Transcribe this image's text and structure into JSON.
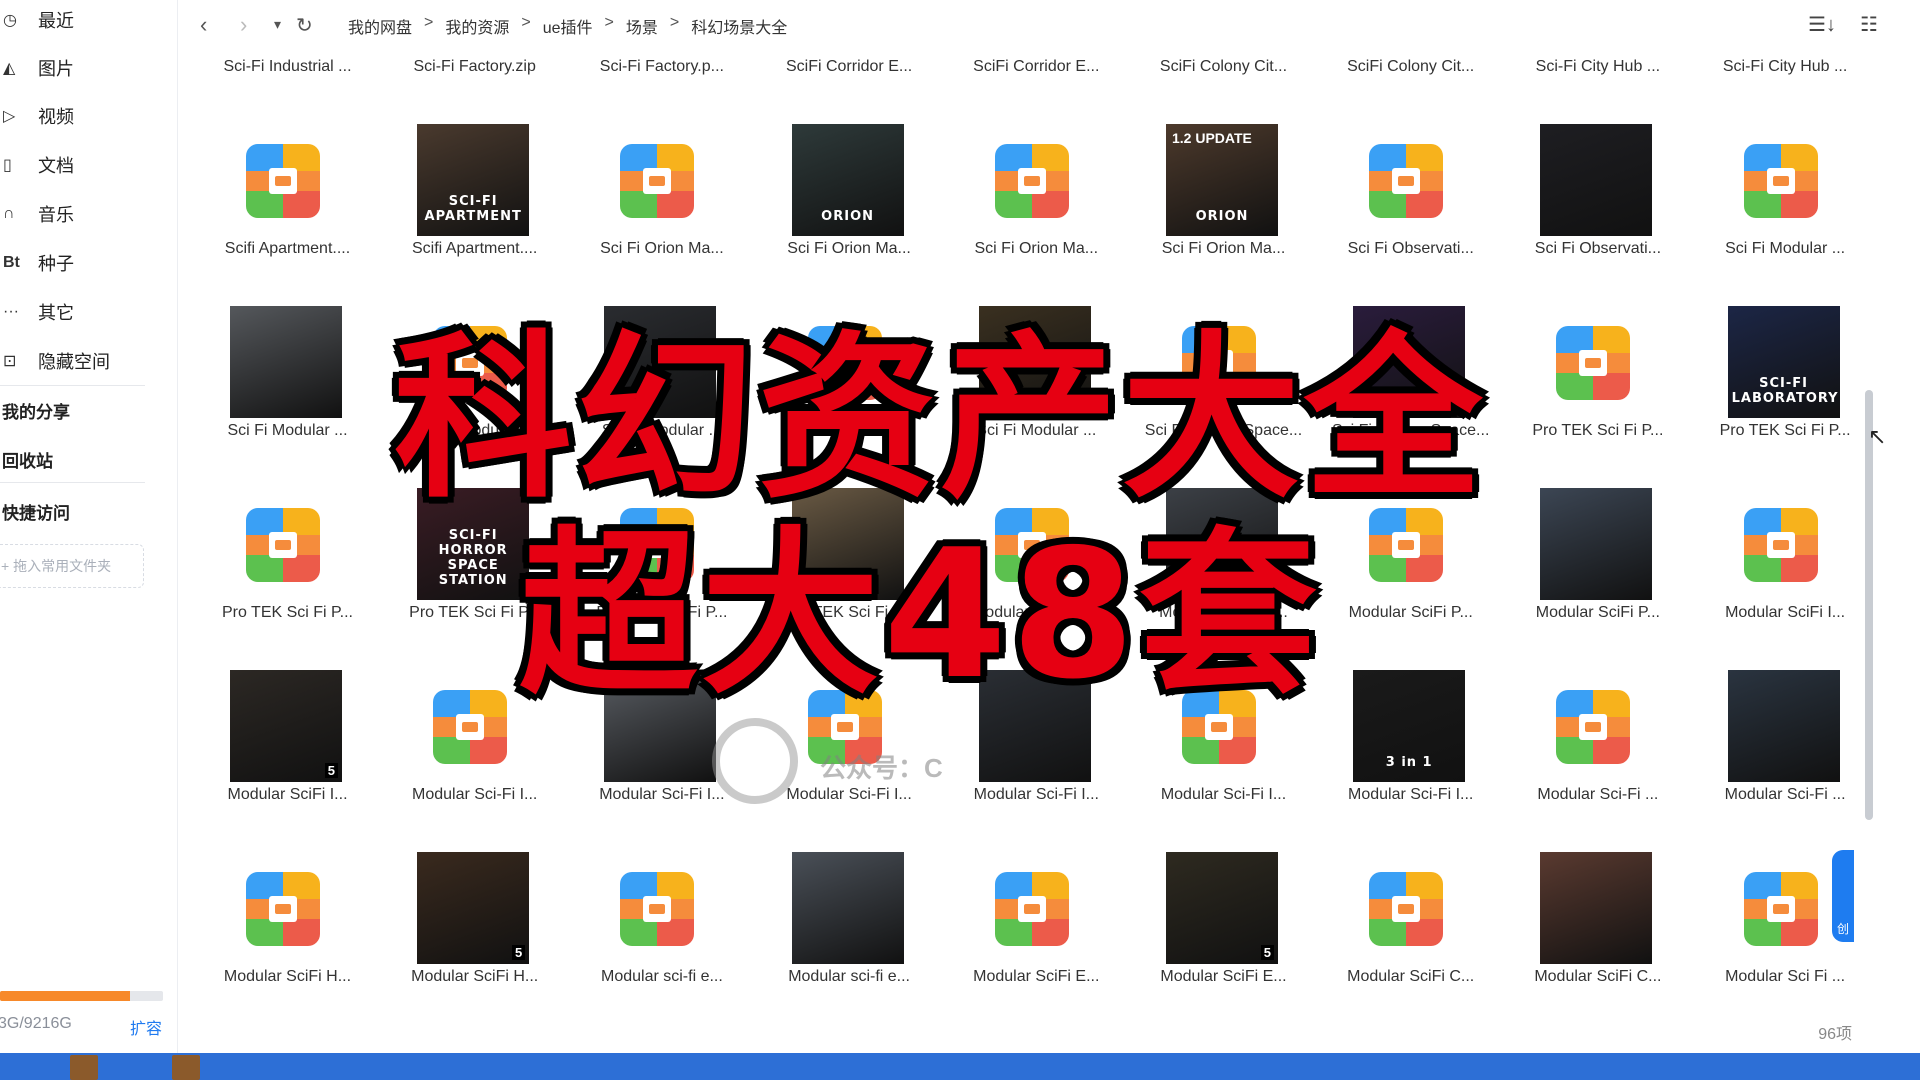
{
  "sidebar": {
    "nav": [
      {
        "icon": "clock-icon",
        "glyph": "◷",
        "label": "最近"
      },
      {
        "icon": "image-icon",
        "glyph": "◭",
        "label": "图片"
      },
      {
        "icon": "video-icon",
        "glyph": "▷",
        "label": "视频"
      },
      {
        "icon": "document-icon",
        "glyph": "▯",
        "label": "文档"
      },
      {
        "icon": "headphones-icon",
        "glyph": "∩",
        "label": "音乐"
      },
      {
        "icon": "bt-icon",
        "glyph": "Bt",
        "label": "种子"
      },
      {
        "icon": "more-icon",
        "glyph": "···",
        "label": "其它"
      },
      {
        "icon": "lock-icon",
        "glyph": "⊡",
        "label": "隐藏空间"
      }
    ],
    "my_share": "我的分享",
    "recycle_bin": "回收站",
    "quick_access": "快捷访问",
    "drop_folder": "+ 拖入常用文件夹",
    "storage_text": "3G/9216G",
    "storage_fraction": 0.8,
    "expand": "扩容"
  },
  "topbar": {
    "breadcrumb": [
      "我的网盘",
      "我的资源",
      "ue插件",
      "场景",
      "科幻场景大全"
    ],
    "separator": ">"
  },
  "grid": {
    "rows": [
      [
        {
          "name": "Sci-Fi Industrial ...",
          "kind": "zip"
        },
        {
          "name": "Sci-Fi Factory.zip",
          "kind": "zip"
        },
        {
          "name": "Sci-Fi Factory.p...",
          "kind": "zip"
        },
        {
          "name": "SciFi Corridor E...",
          "kind": "zip"
        },
        {
          "name": "SciFi Corridor E...",
          "kind": "zip"
        },
        {
          "name": "SciFi Colony Cit...",
          "kind": "zip"
        },
        {
          "name": "SciFi Colony Cit...",
          "kind": "zip"
        },
        {
          "name": "Sci-Fi City Hub ...",
          "kind": "zip"
        },
        {
          "name": "Sci-Fi City Hub ...",
          "kind": "zip"
        }
      ],
      [
        {
          "name": "Scifi Apartment....",
          "kind": "zip"
        },
        {
          "name": "Scifi Apartment....",
          "kind": "photo",
          "bg": "#4a3a2e",
          "cap": "SCI-FI APARTMENT"
        },
        {
          "name": "Sci Fi Orion Ma...",
          "kind": "zip"
        },
        {
          "name": "Sci Fi Orion Ma...",
          "kind": "photo",
          "bg": "#2e3a3a",
          "cap": "ORION"
        },
        {
          "name": "Sci Fi Orion Ma...",
          "kind": "zip"
        },
        {
          "name": "Sci Fi Orion Ma...",
          "kind": "photo",
          "bg": "#4d3a2c",
          "cap": "ORION",
          "cap2": "1.2 UPDATE"
        },
        {
          "name": "Sci Fi Observati...",
          "kind": "zip"
        },
        {
          "name": "Sci Fi Observati...",
          "kind": "photo",
          "bg": "#1e1e22",
          "cap": ""
        },
        {
          "name": "Sci Fi Modular ...",
          "kind": "zip"
        }
      ],
      [
        {
          "name": "Sci Fi Modular ...",
          "kind": "photo",
          "bg": "#55585c",
          "cap": ""
        },
        {
          "name": "Sci Fi Modular ...",
          "kind": "zip"
        },
        {
          "name": "Sci Fi Modular ...",
          "kind": "photo",
          "bg": "#2a2c30",
          "cap": ""
        },
        {
          "name": "Sci Fi Modular ...",
          "kind": "zip"
        },
        {
          "name": "Sci Fi Modular ...",
          "kind": "photo",
          "bg": "#3a3020",
          "cap": ""
        },
        {
          "name": "Sci Fi Colony Space...",
          "kind": "zip"
        },
        {
          "name": "Sci Fi Colony Space...",
          "kind": "photo",
          "bg": "#2a1c3c",
          "cap": ""
        },
        {
          "name": "Pro TEK Sci Fi P...",
          "kind": "zip"
        },
        {
          "name": "Pro TEK Sci Fi P...",
          "kind": "photo",
          "bg": "#1c2646",
          "cap": "SCI-FI LABORATORY"
        }
      ],
      [
        {
          "name": "Pro TEK Sci Fi P...",
          "kind": "zip"
        },
        {
          "name": "Pro TEK Sci Fi P...",
          "kind": "photo",
          "bg": "#3a1c24",
          "cap": "SCI-FI HORROR SPACE STATION"
        },
        {
          "name": "Pro TEK Sci Fi P...",
          "kind": "zip"
        },
        {
          "name": "Pro TEK Sci Fi P...",
          "kind": "photo",
          "bg": "#6a5a44",
          "cap": ""
        },
        {
          "name": "Modular Sci Fi P...",
          "kind": "zip"
        },
        {
          "name": "Modular Sci Fi P...",
          "kind": "photo",
          "bg": "#3c4046",
          "cap": ""
        },
        {
          "name": "Modular SciFi P...",
          "kind": "zip"
        },
        {
          "name": "Modular SciFi P...",
          "kind": "photo",
          "bg": "#3c4654",
          "cap": ""
        },
        {
          "name": "Modular SciFi I...",
          "kind": "zip"
        }
      ],
      [
        {
          "name": "Modular SciFi I...",
          "kind": "photo",
          "bg": "#2c2824",
          "cap": "",
          "badge": "5"
        },
        {
          "name": "Modular Sci-Fi I...",
          "kind": "zip"
        },
        {
          "name": "Modular Sci-Fi I...",
          "kind": "photo",
          "bg": "#5a5e64",
          "cap": ""
        },
        {
          "name": "Modular Sci-Fi I...",
          "kind": "zip"
        },
        {
          "name": "Modular Sci-Fi I...",
          "kind": "photo",
          "bg": "#2a2e34",
          "cap": ""
        },
        {
          "name": "Modular Sci-Fi I...",
          "kind": "zip"
        },
        {
          "name": "Modular Sci-Fi I...",
          "kind": "photo",
          "bg": "#1a1a1a",
          "cap": "3 in 1"
        },
        {
          "name": "Modular Sci-Fi ...",
          "kind": "zip"
        },
        {
          "name": "Modular Sci-Fi ...",
          "kind": "photo",
          "bg": "#2a3440",
          "cap": ""
        }
      ],
      [
        {
          "name": "Modular SciFi H...",
          "kind": "zip"
        },
        {
          "name": "Modular SciFi H...",
          "kind": "photo",
          "bg": "#3a2a1e",
          "cap": "",
          "badge": "5"
        },
        {
          "name": "Modular sci-fi e...",
          "kind": "zip"
        },
        {
          "name": "Modular sci-fi e...",
          "kind": "photo",
          "bg": "#4a5058",
          "cap": ""
        },
        {
          "name": "Modular SciFi E...",
          "kind": "zip"
        },
        {
          "name": "Modular SciFi E...",
          "kind": "photo",
          "bg": "#2e2a20",
          "cap": "",
          "badge": "5"
        },
        {
          "name": "Modular SciFi C...",
          "kind": "zip"
        },
        {
          "name": "Modular SciFi C...",
          "kind": "photo",
          "bg": "#5a3a30",
          "cap": ""
        },
        {
          "name": "Modular Sci Fi ...",
          "kind": "zip"
        }
      ]
    ]
  },
  "item_count": "96项",
  "overlay": {
    "line1": "科幻资产大全",
    "line2": "超大48套"
  },
  "watermark": "公众号：C",
  "float_badge": "创",
  "colors": {
    "accent": "#1f7af0",
    "overlay_red": "#e60012",
    "storage_orange": "#f7892a",
    "taskbar": "#2d6fd6"
  }
}
